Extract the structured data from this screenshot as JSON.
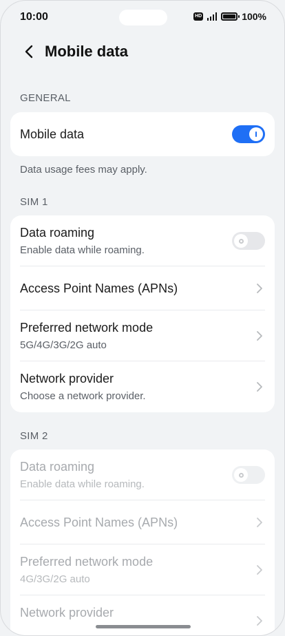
{
  "status": {
    "time": "10:00",
    "hd": "HD",
    "battery": "100%"
  },
  "header": {
    "title": "Mobile data"
  },
  "general": {
    "label": "GENERAL",
    "mobile_data": {
      "label": "Mobile data",
      "enabled": true
    },
    "note": "Data usage fees may apply."
  },
  "sim1": {
    "label": "SIM 1",
    "data_roaming": {
      "label": "Data roaming",
      "subtitle": "Enable data while roaming.",
      "enabled": false
    },
    "apn": {
      "label": "Access Point Names (APNs)"
    },
    "network_mode": {
      "label": "Preferred network mode",
      "subtitle": "5G/4G/3G/2G auto"
    },
    "provider": {
      "label": "Network provider",
      "subtitle": "Choose a network provider."
    }
  },
  "sim2": {
    "label": "SIM 2",
    "data_roaming": {
      "label": "Data roaming",
      "subtitle": "Enable data while roaming.",
      "enabled": false
    },
    "apn": {
      "label": "Access Point Names (APNs)"
    },
    "network_mode": {
      "label": "Preferred network mode",
      "subtitle": "4G/3G/2G auto"
    },
    "provider": {
      "label": "Network provider"
    }
  },
  "colors": {
    "accent": "#1f6ff5",
    "background": "#f1f3f5"
  }
}
